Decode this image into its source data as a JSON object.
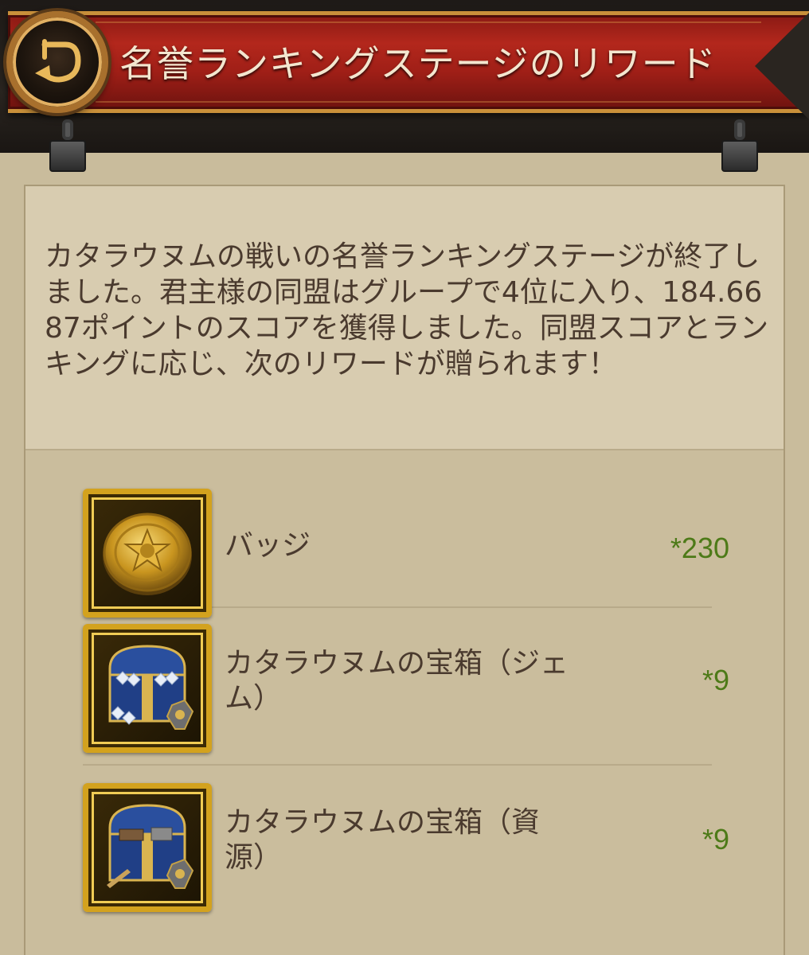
{
  "header": {
    "title": "名誉ランキングステージのリワード"
  },
  "message": {
    "text": "カタラウヌムの戦いの名誉ランキングステージが終了しました。君主様の同盟はグループで4位に入り、184.6687ポイントのスコアを獲得しました。同盟スコアとランキングに応じ、次のリワードが贈られます！"
  },
  "rewards": [
    {
      "name": "バッジ",
      "quantity": "*230",
      "icon": "badge-medal-icon"
    },
    {
      "name": "カタラウヌムの宝箱（ジェム）",
      "quantity": "*9",
      "icon": "gem-chest-icon"
    },
    {
      "name": "カタラウヌムの宝箱（資源）",
      "quantity": "*9",
      "icon": "resource-chest-icon"
    }
  ],
  "colors": {
    "banner_red": "#a01f17",
    "gold_frame": "#d3a21e",
    "quantity_green": "#4d7a18",
    "body_text": "#4a3a2e"
  }
}
